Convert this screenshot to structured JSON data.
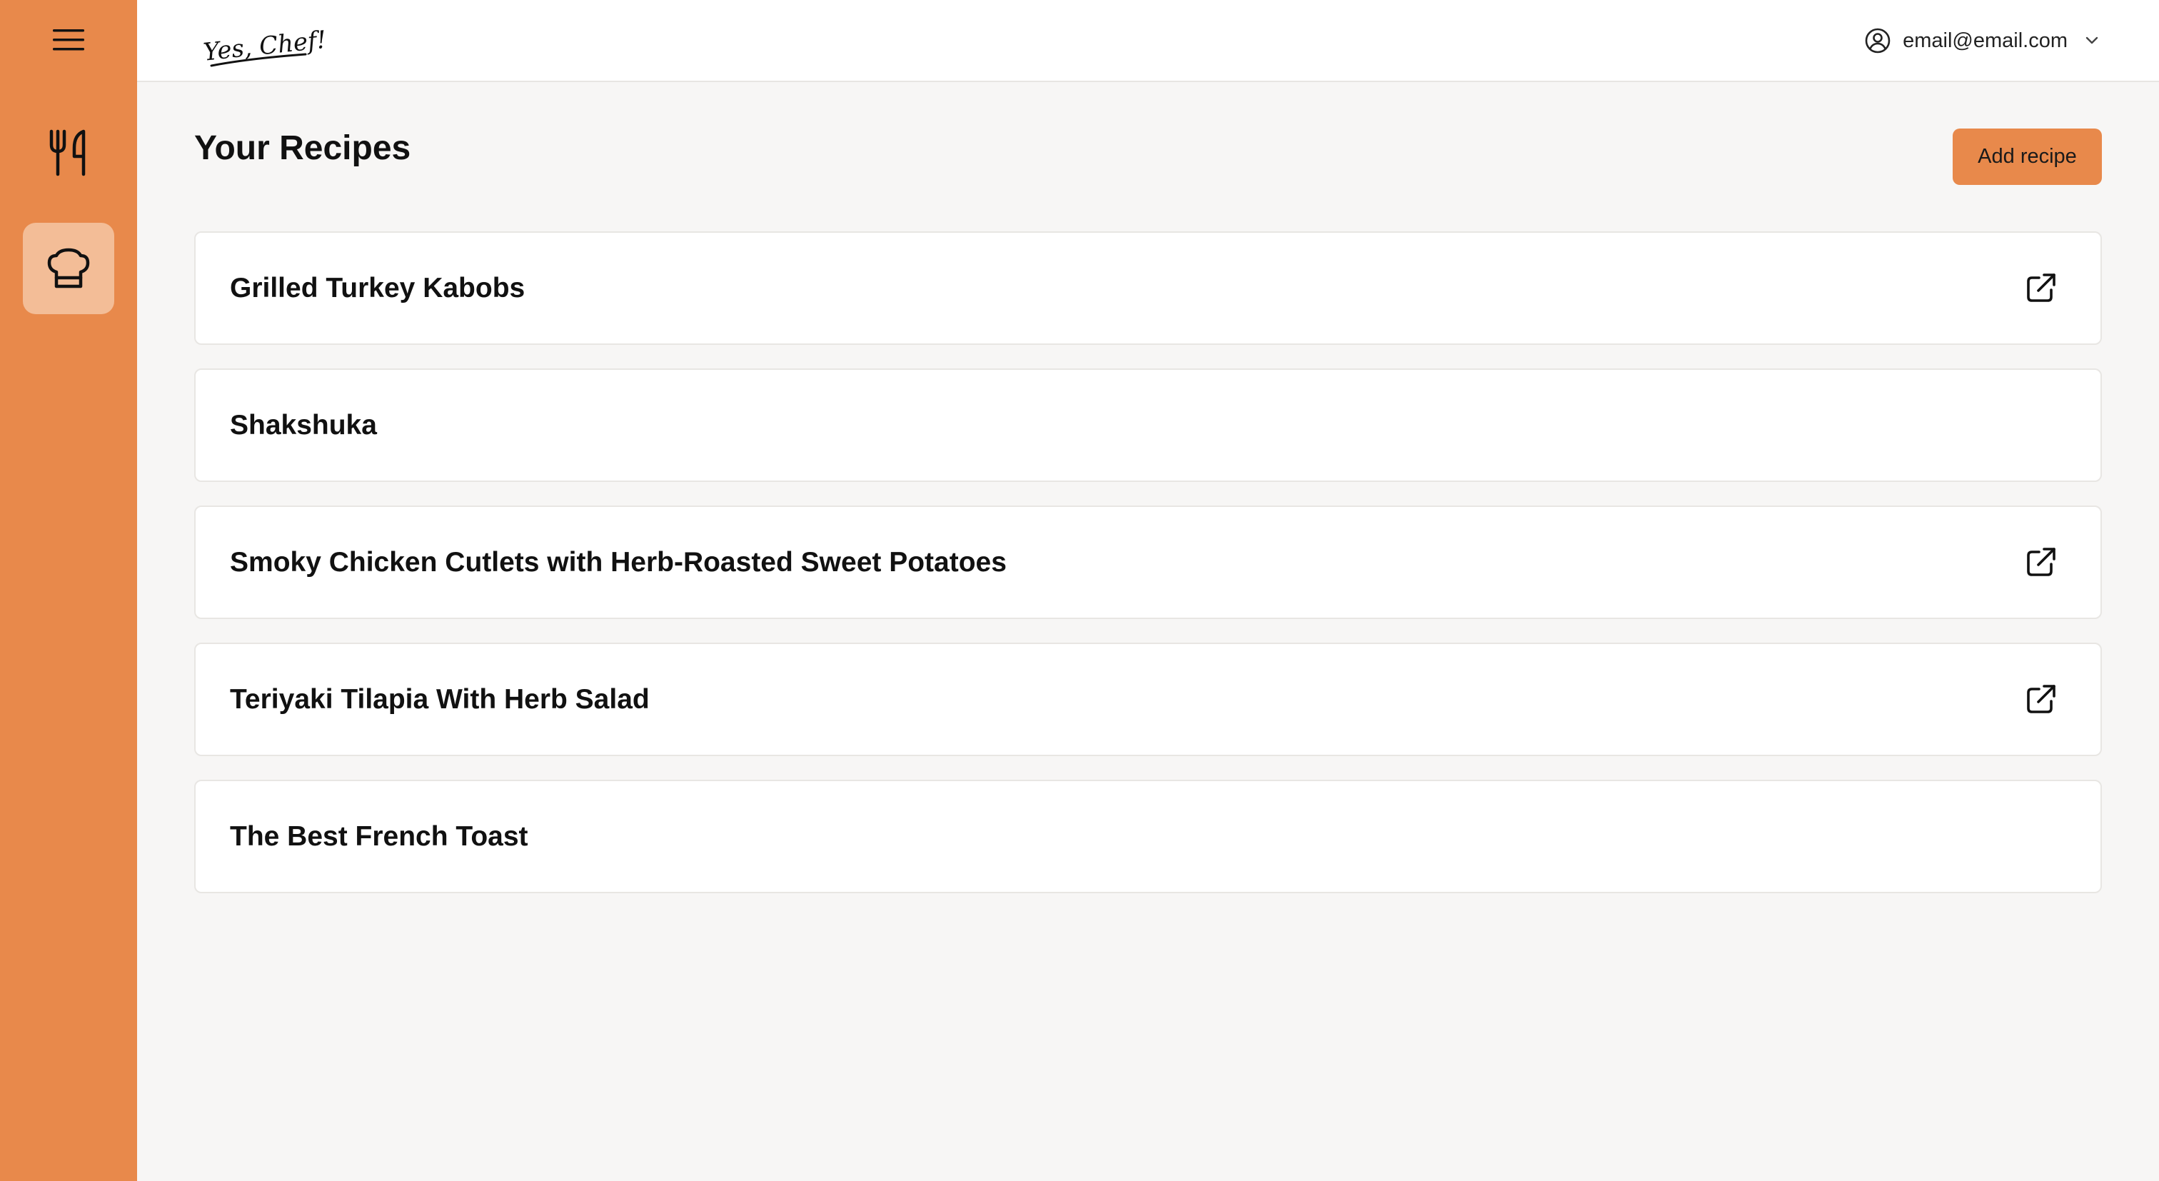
{
  "app": {
    "logo_text": "Yes, Chef!",
    "accent_color": "#e8894b",
    "active_nav_color": "#f3bd97"
  },
  "sidebar": {
    "items": [
      {
        "name": "menu",
        "icon": "hamburger-menu-icon"
      },
      {
        "name": "recipes",
        "icon": "fork-knife-icon"
      },
      {
        "name": "chef",
        "icon": "chef-hat-icon",
        "active": true
      }
    ]
  },
  "header": {
    "user_email": "email@email.com",
    "user_icon": "user-circle-icon",
    "dropdown_icon": "chevron-down-icon"
  },
  "main": {
    "title": "Your Recipes",
    "add_button_label": "Add recipe",
    "recipes": [
      {
        "title": "Grilled Turkey Kabobs",
        "has_link": true
      },
      {
        "title": "Shakshuka",
        "has_link": false
      },
      {
        "title": "Smoky Chicken Cutlets with Herb-Roasted Sweet Potatoes",
        "has_link": true
      },
      {
        "title": "Teriyaki Tilapia With Herb Salad",
        "has_link": true
      },
      {
        "title": "The Best French Toast",
        "has_link": false
      }
    ]
  }
}
